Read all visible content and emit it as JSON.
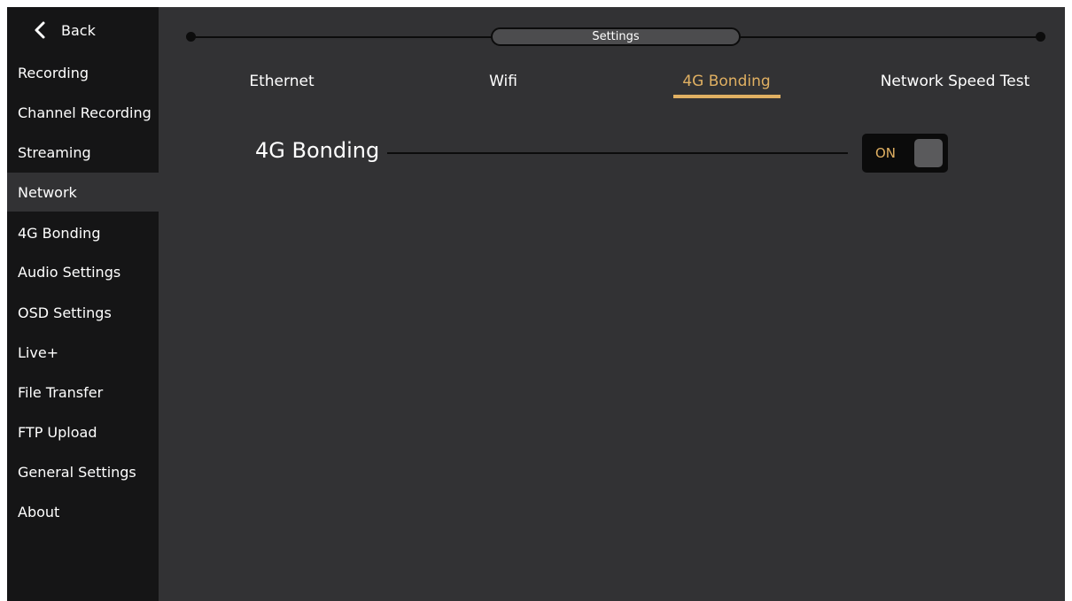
{
  "sidebar": {
    "back_label": "Back",
    "items": [
      {
        "label": "Recording"
      },
      {
        "label": "Channel Recording"
      },
      {
        "label": "Streaming"
      },
      {
        "label": "Network",
        "active": true
      },
      {
        "label": "4G Bonding"
      },
      {
        "label": "Audio Settings"
      },
      {
        "label": "OSD Settings"
      },
      {
        "label": "Live+"
      },
      {
        "label": "File Transfer"
      },
      {
        "label": "FTP Upload"
      },
      {
        "label": "General Settings"
      },
      {
        "label": "About"
      }
    ]
  },
  "header": {
    "title": "Settings"
  },
  "tabs": [
    {
      "label": "Ethernet"
    },
    {
      "label": "Wifi"
    },
    {
      "label": "4G Bonding",
      "active": true
    },
    {
      "label": "Network Speed Test"
    }
  ],
  "section": {
    "title": "4G Bonding",
    "toggle": {
      "state_label": "ON",
      "on": true
    }
  },
  "colors": {
    "accent": "#e0b062",
    "background": "#323234",
    "sidebar": "#151516"
  },
  "icons": {
    "back": "chevron-left-icon"
  }
}
